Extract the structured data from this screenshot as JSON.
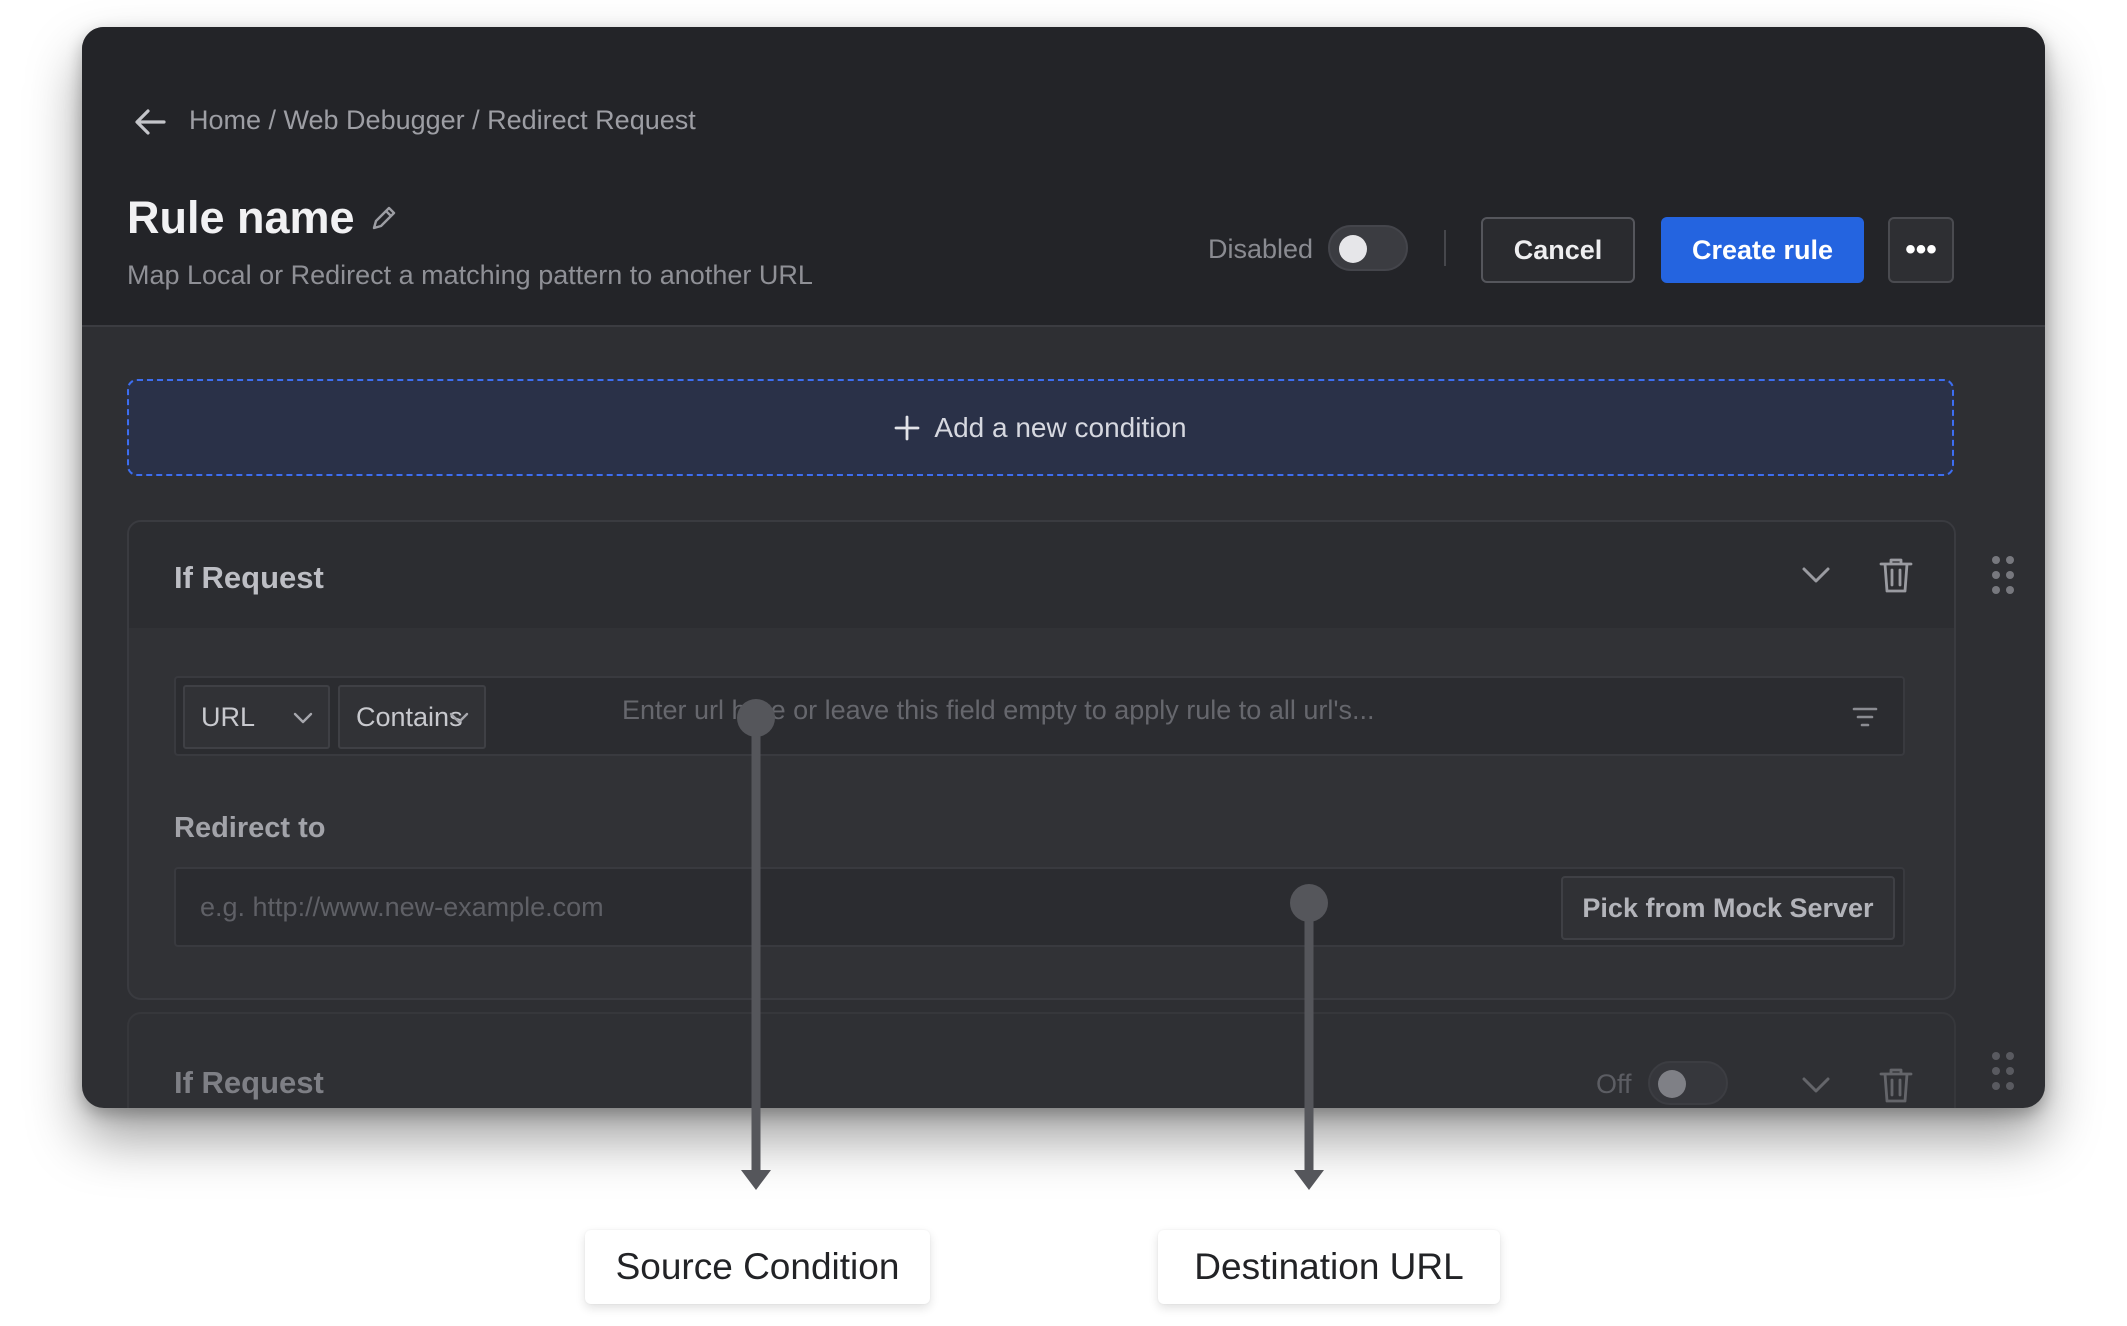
{
  "header": {
    "back_icon": "arrow-left-icon",
    "breadcrumb": "Home / Web Debugger / Redirect Request",
    "title": "Rule name",
    "edit_icon": "pencil-icon",
    "subtitle": "Map Local or Redirect a matching pattern to another URL",
    "status_label": "Disabled",
    "status_enabled": false,
    "cancel_label": "Cancel",
    "create_label": "Create rule",
    "more_label": "•••",
    "accent_color": "#2464e0"
  },
  "add_condition": {
    "label": "Add a new condition",
    "icon": "plus-icon"
  },
  "rule_card": {
    "title": "If Request",
    "source_field": "URL",
    "operator": "Contains",
    "url_placeholder": "Enter url here or leave this field empty to apply rule to all url's...",
    "redirect_label": "Redirect to",
    "redirect_placeholder": "e.g. http://www.new-example.com",
    "mock_button_label": "Pick from Mock Server"
  },
  "rule_card_2": {
    "title": "If Request",
    "toggle_label": "Off",
    "enabled": false
  },
  "callouts": {
    "source": "Source Condition",
    "destination": "Destination URL"
  }
}
